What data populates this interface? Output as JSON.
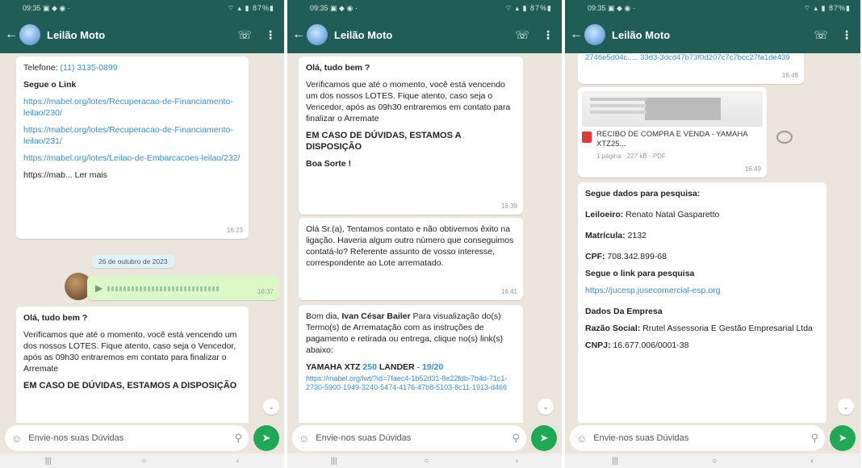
{
  "chat": {
    "contact_name": "Leilão Moto",
    "input_placeholder": "Envie-nos suas Dúvidas"
  },
  "phone1": {
    "msg1": {
      "phone_label": "Telefone:",
      "phone_value": "(11) 3135-0899",
      "heading": "Segue o Link",
      "link1": "https://mabel.org/lotes/Recuperacao-de-Financiamento-leilao/230/",
      "link2": "https://mabel.org/lotes/Recuperacao-de-Financiamento-leilao/231/",
      "link3": "https://mabel.org/lotes/Leilao-de-Embarcacoes-leilao/232/",
      "link4": "https://mab... Ler mais",
      "time": "16:23"
    },
    "date_chip": "26 de outubro de 2023",
    "voice": {
      "time": "16:37"
    },
    "msg2": {
      "greeting": "Olá, tudo bem ?",
      "body": "Verificamos que até o momento, você está vencendo um dos nossos LOTES. Fique atento, caso seja o Vencedor, após as 09h30 entraremos em contato para finalizar o Arremate",
      "footer": "EM CASO DE DÚVIDAS, ESTAMOS A DISPOSIÇÃO"
    }
  },
  "phone2": {
    "msg1": {
      "greeting": "Olá, tudo bem ?",
      "body": "Verificamos que até o momento, você está vencendo um dos nossos LOTES. Fique atento, caso seja o Vencedor, após as 09h30 entraremos em contato para finalizar o Arremate",
      "footer": "EM CASO DE DÚVIDAS, ESTAMOS A DISPOSIÇÃO",
      "sign": "Boa Sorte !",
      "time": "16:39"
    },
    "msg2": {
      "text": "Olá Sr.(a), Tentamos contato e não obtivemos êxito na ligação. Haveria algum outro número que conseguimos contatá-lo? Referente assunto de vosso interesse, correspondente ao Lote arrematado.",
      "time": "16:41"
    },
    "msg3": {
      "intro_prefix": "Bom dia,",
      "name": "Ivan César Bailer",
      "intro_suffix": "Para visualização do(s) Termo(s) de Arrematação com as instruções de pagamento e retirada ou entrega, clique no(s) link(s) abaixo:",
      "product": "YAMAHA XTZ",
      "product_mid": "250",
      "product_end": "LANDER",
      "product_suffix": "- 19/20",
      "link": "https://mabel.org/lwt/?id=7faec4-1b52d31-8e22fdb-7b4d-71c1-2730-5900-1949-3240-5474-4176-47b8-5103-8c11-1913-d466"
    }
  },
  "phone3": {
    "msg1": {
      "link_fragment": "2746e5d04c.....  33d3-3dcd47b73f0d207c7c7bcc27fa1de439",
      "time": "16:48"
    },
    "doc": {
      "title": "RECIBO DE COMPRA E VENDA - YAMAHA XTZ25...",
      "meta": "1 página · 227 kB · PDF",
      "time": "16:49"
    },
    "msg2": {
      "heading": "Segue dados para pesquisa:",
      "leiloeiro_label": "Leiloeiro:",
      "leiloeiro_value": "Renato Natal Gasparetto",
      "matricula_label": "Matrícula:",
      "matricula_value": "2132",
      "cpf_label": "CPF:",
      "cpf_value": "708.342.899-68",
      "link_heading": "Segue o link para pesquisa",
      "link": "https://jucesp.jusecomercial-esp.org",
      "company_heading": "Dados Da Empresa",
      "razao_label": "Razão Social:",
      "razao_value": "Rrutel Assessoria E Gestão Empresarial Ltda",
      "cnpj_label": "CNPJ:",
      "cnpj_value": "16.677.006/0001-38"
    }
  }
}
